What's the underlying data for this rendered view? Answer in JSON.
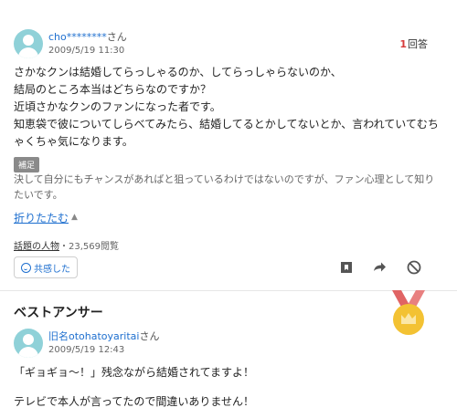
{
  "question": {
    "user": {
      "name": "cho********",
      "honorific": "さん"
    },
    "date": "2009/5/19 11:30",
    "answers_count": {
      "number": "1",
      "label": "回答"
    },
    "text": "さかなクンは結婚してらっしゃるのか、してらっしゃらないのか、\n結局のところ本当はどちらなのですか？\n近頃さかなクンのファンになった者です。\n知恵袋で彼についてしらべてみたら、結婚してるとかしてないとか、言われていてむちゃくちゃ気になります。",
    "supplement": {
      "label": "補足",
      "text": "決して自分にもチャンスがあればと狙っているわけではないのですが、ファン心理として知りたいです。"
    },
    "collapse_label": "折りたたむ",
    "topic_link": "話題の人物",
    "views": "・23,569閲覧",
    "empathy_label": "共感した",
    "icons": [
      "bookmark-icon",
      "share-icon",
      "block-icon"
    ]
  },
  "best_answer": {
    "title": "ベストアンサー",
    "user": {
      "name": "旧名otohatoyaritai",
      "honorific": "さん"
    },
    "date": "2009/5/19 12:43",
    "text": "「ギョギョ～！」残念ながら結婚されてますよ！\n\nテレビで本人が言ってたので間違いありません！",
    "medal_icon": "crown-medal-icon"
  },
  "colors": {
    "link": "#1e6fcf",
    "count": "#d63b3b",
    "medal_ribbon": "#e06464",
    "medal_gold": "#f3c233",
    "avatar": "#8fd1d8"
  }
}
